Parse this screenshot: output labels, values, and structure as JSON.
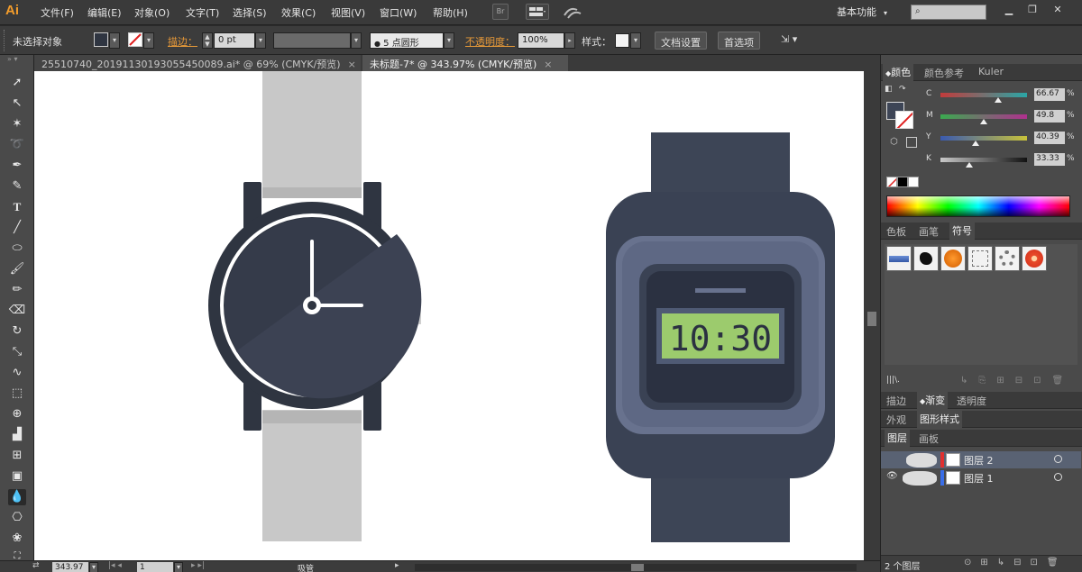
{
  "app": {
    "logo": "Ai"
  },
  "menu": [
    "文件(F)",
    "编辑(E)",
    "对象(O)",
    "文字(T)",
    "选择(S)",
    "效果(C)",
    "视图(V)",
    "窗口(W)",
    "帮助(H)"
  ],
  "menu_badge": "Br",
  "workspace": {
    "label": "基本功能"
  },
  "control": {
    "selection_status": "未选择对象",
    "stroke_label": "描边：",
    "stroke_value": "0 pt",
    "brush_label": "5 点圆形",
    "opacity_label": "不透明度：",
    "opacity_value": "100%",
    "style_label": "样式：",
    "doc_setup_button": "文档设置",
    "preferences_button": "首选项"
  },
  "tabs": [
    {
      "label": "25510740_20191130193055450089.ai* @ 69% (CMYK/预览)",
      "active": false
    },
    {
      "label": "未标题-7* @ 343.97% (CMYK/预览)",
      "active": true
    }
  ],
  "canvas": {
    "digital_watch_time": "10:30",
    "colors": {
      "dark_navy": "#2f3541",
      "strap_light": "#c8c8c8",
      "watch_blue": "#3d4556",
      "bezel_blue": "#68728e",
      "lcd_green": "#9ccb6d"
    }
  },
  "status": {
    "zoom": "343.97",
    "page": "1",
    "tool_name": "吸管"
  },
  "color_panel": {
    "tabs": [
      "颜色",
      "颜色参考",
      "Kuler"
    ],
    "active_tab": "颜色",
    "sliders": [
      {
        "channel": "C",
        "value": "66.67",
        "fraction": 0.667,
        "gradient": [
          "#c23b3b",
          "#2aa6a6"
        ]
      },
      {
        "channel": "M",
        "value": "49.8",
        "fraction": 0.498,
        "gradient": [
          "#3aaa4f",
          "#b0308e"
        ]
      },
      {
        "channel": "Y",
        "value": "40.39",
        "fraction": 0.404,
        "gradient": [
          "#3a5ab0",
          "#c8c23a"
        ]
      },
      {
        "channel": "K",
        "value": "33.33",
        "fraction": 0.333,
        "gradient": [
          "#c8c8c8",
          "#111111"
        ]
      }
    ],
    "pct": "%"
  },
  "symbols_panel": {
    "tabs": [
      "色板",
      "画笔",
      "符号"
    ],
    "active_tab": "符号",
    "library_label": "|||\\."
  },
  "stroke_panel": {
    "tabs": [
      "描边",
      "渐变",
      "透明度"
    ],
    "active_tab": "渐变"
  },
  "appearance_panel": {
    "tabs": [
      "外观",
      "图形样式"
    ],
    "active_tab": "图形样式"
  },
  "layers_panel": {
    "tabs": [
      "图层",
      "画板"
    ],
    "active_tab": "图层",
    "layers": [
      {
        "name": "图层 2",
        "selected": true
      },
      {
        "name": "图层 1",
        "selected": false
      }
    ],
    "count_label": "2 个图层"
  }
}
